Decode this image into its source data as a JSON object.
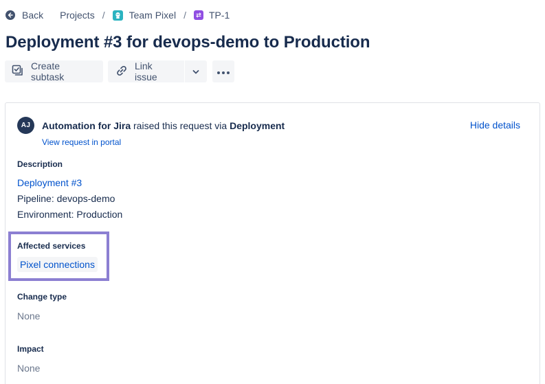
{
  "breadcrumb": {
    "back_label": "Back",
    "projects_label": "Projects",
    "team_label": "Team Pixel",
    "issue_key": "TP-1",
    "separator": "/"
  },
  "issue": {
    "title": "Deployment #3 for devops-demo to Production"
  },
  "toolbar": {
    "create_subtask_label": "Create subtask",
    "link_issue_label": "Link issue"
  },
  "request": {
    "reporter": "Automation for Jira",
    "raised_text": "raised this request via",
    "channel": "Deployment",
    "avatar_initials": "AJ",
    "portal_link": "View request in portal",
    "hide_details": "Hide details"
  },
  "description": {
    "label": "Description",
    "link_text": "Deployment #3",
    "pipeline_line": "Pipeline: devops-demo",
    "environment_line": "Environment: Production"
  },
  "affected_services": {
    "label": "Affected services",
    "services": [
      "Pixel connections"
    ]
  },
  "change_type": {
    "label": "Change type",
    "value": "None"
  },
  "impact": {
    "label": "Impact",
    "value": "None"
  },
  "colors": {
    "link": "#0052cc",
    "text": "#172b4d",
    "subtle": "#6b778c",
    "highlight_border": "#8c7fd2",
    "team_icon": "#2bb3c0",
    "issue_icon": "#904ee2"
  },
  "icons": [
    "back-icon",
    "team-pixel-icon",
    "issue-type-icon",
    "subtask-icon",
    "link-icon",
    "chevron-down-icon",
    "more-icon"
  ]
}
